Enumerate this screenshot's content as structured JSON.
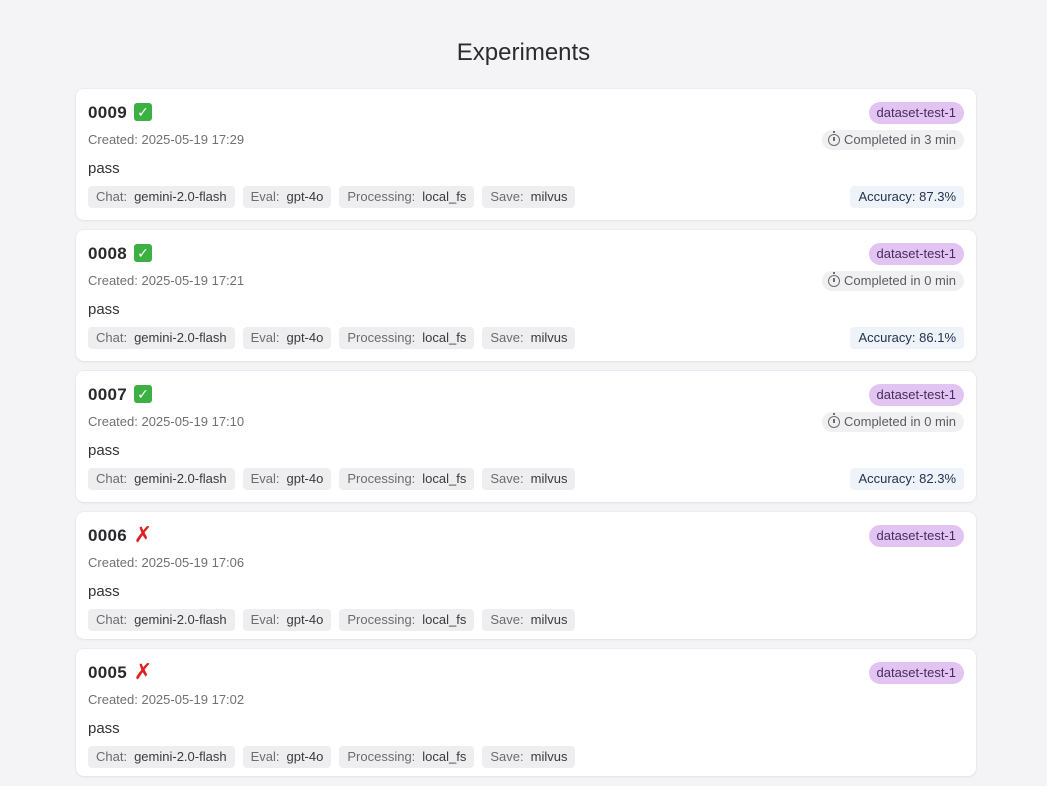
{
  "page": {
    "title": "Experiments"
  },
  "labels": {
    "chat": "Chat:",
    "eval": "Eval:",
    "processing": "Processing:",
    "save": "Save:"
  },
  "colors": {
    "dataset_badge_bg": "#e2c4f3",
    "success": "#3cb043",
    "failed": "#e02020",
    "accuracy_bg": "#eef3fa"
  },
  "experiments": [
    {
      "id": "0009",
      "status": "success",
      "status_icon": "check-icon",
      "created": "Created: 2025-05-19 17:29",
      "result": "pass",
      "dataset": "dataset-test-1",
      "duration": "Completed in 3 min",
      "accuracy": "Accuracy: 87.3%",
      "chat": "gemini-2.0-flash",
      "eval": "gpt-4o",
      "processing": "local_fs",
      "save": "milvus"
    },
    {
      "id": "0008",
      "status": "success",
      "status_icon": "check-icon",
      "created": "Created: 2025-05-19 17:21",
      "result": "pass",
      "dataset": "dataset-test-1",
      "duration": "Completed in 0 min",
      "accuracy": "Accuracy: 86.1%",
      "chat": "gemini-2.0-flash",
      "eval": "gpt-4o",
      "processing": "local_fs",
      "save": "milvus"
    },
    {
      "id": "0007",
      "status": "success",
      "status_icon": "check-icon",
      "created": "Created: 2025-05-19 17:10",
      "result": "pass",
      "dataset": "dataset-test-1",
      "duration": "Completed in 0 min",
      "accuracy": "Accuracy: 82.3%",
      "chat": "gemini-2.0-flash",
      "eval": "gpt-4o",
      "processing": "local_fs",
      "save": "milvus"
    },
    {
      "id": "0006",
      "status": "failed",
      "status_icon": "cross-icon",
      "created": "Created: 2025-05-19 17:06",
      "result": "pass",
      "dataset": "dataset-test-1",
      "duration": null,
      "accuracy": null,
      "chat": "gemini-2.0-flash",
      "eval": "gpt-4o",
      "processing": "local_fs",
      "save": "milvus"
    },
    {
      "id": "0005",
      "status": "failed",
      "status_icon": "cross-icon",
      "created": "Created: 2025-05-19 17:02",
      "result": "pass",
      "dataset": "dataset-test-1",
      "duration": null,
      "accuracy": null,
      "chat": "gemini-2.0-flash",
      "eval": "gpt-4o",
      "processing": "local_fs",
      "save": "milvus"
    }
  ]
}
